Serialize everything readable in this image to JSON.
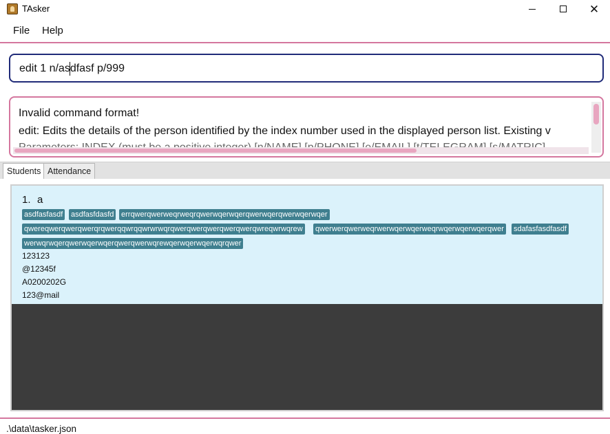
{
  "window": {
    "title": "TAsker",
    "minimize_symbol": "",
    "close_symbol": "✕"
  },
  "menu": {
    "file": "File",
    "help": "Help"
  },
  "command": {
    "value": "edit 1 n/asdfasf p/999"
  },
  "result": {
    "line1": "Invalid command format!",
    "line2": "edit: Edits the details of the person identified by the index number used in the displayed person list. Existing v",
    "line3": "Parameters: INDEX (must be a positive integer) [n/NAME] [p/PHONE] [e/EMAIL] [t/TELEGRAM] [s/MATRIC]"
  },
  "tabs": {
    "students": "Students",
    "attendance": "Attendance"
  },
  "person": {
    "index": "1.",
    "name": "a",
    "tags": [
      "asdfasfasdf",
      "asdfasfdasfd",
      "errqwerqwerweqrweqrqwerwqerwqerqwerwqerqwerwqerwqer",
      "qwereqwerqwerqwerqrqwerqqwrqqwrwrwqrqwerqwerqwerqwerqwerqwreqwrwqrew",
      "qwerwerqwerweqrwerwqerwqerweqrwqerwqerwqerqwer",
      "sdafasfasdfasdf",
      "werwqrwqerqwerwqerwqerqwerqwerwqrewqerwqerwqerwqrqwer"
    ],
    "phone": "123123",
    "telegram": "@12345f",
    "matric": "A0200202G",
    "email": "123@mail"
  },
  "status": {
    "path": ".\\data\\tasker.json"
  },
  "colors": {
    "accent": "#d4769e",
    "command_border": "#1f2a78",
    "tag_bg": "#3f7f8f",
    "card_bg": "#dbf2fb",
    "list_bg": "#3c3c3c"
  }
}
